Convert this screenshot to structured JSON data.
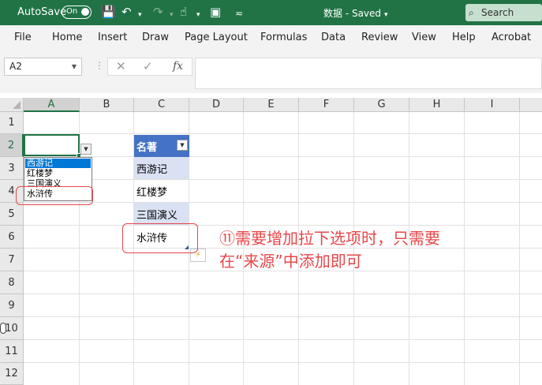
{
  "titlebar": {
    "autosave_label": "AutoSave",
    "autosave_state": "On",
    "document_title": "数据 - Saved",
    "search_placeholder": "Search"
  },
  "ribbon": {
    "tabs": [
      "File",
      "Home",
      "Insert",
      "Draw",
      "Page Layout",
      "Formulas",
      "Data",
      "Review",
      "View",
      "Help",
      "Acrobat"
    ]
  },
  "formula_bar": {
    "name_box": "A2",
    "content": ""
  },
  "grid": {
    "columns": [
      "A",
      "B",
      "C",
      "D",
      "E",
      "F",
      "G",
      "H",
      "I"
    ],
    "rows": [
      "1",
      "2",
      "3",
      "4",
      "5",
      "6",
      "7",
      "8",
      "9",
      "10",
      "11",
      "12"
    ],
    "active_cell": "A2"
  },
  "dropdown": {
    "options": [
      "西游记",
      "红楼梦",
      "三国演义",
      "水浒传"
    ],
    "highlighted_index": 0
  },
  "table": {
    "header": "名著",
    "rows": [
      "西游记",
      "红楼梦",
      "三国演义",
      "水浒传"
    ]
  },
  "annotation": {
    "text": "⑪需要增加拉下选项时，只需要在“来源”中添加即可"
  },
  "colors": {
    "excel_green": "#217346",
    "table_header": "#4472c4",
    "table_band": "#d9e1f2",
    "annotation_red": "#e8474a",
    "selection_blue": "#0078d7"
  }
}
